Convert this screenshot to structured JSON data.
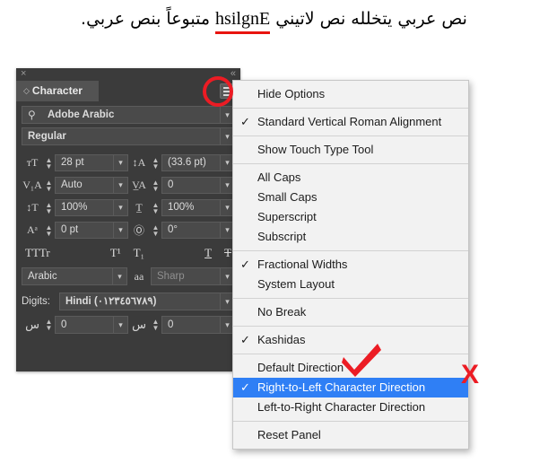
{
  "sample": {
    "line1_before": "نص عربي يتخلله نص لاتيني ",
    "latin_word": "hsilgnE",
    "line1_after": " متبوعاً بنص عربي.",
    "underline_color": "#e8140f"
  },
  "panel": {
    "title": "Character",
    "close_icon": "×",
    "collapse_icon": "«",
    "menu_icon": "hamburger-icon",
    "font_family": {
      "value": "Adobe Arabic",
      "search_icon": "⌕"
    },
    "font_style": {
      "value": "Regular"
    },
    "metrics": [
      {
        "glyph": "T",
        "icon_name": "font-size-icon",
        "value": "28 pt"
      },
      {
        "glyph": "A",
        "icon_name": "leading-icon",
        "value": "(33.6 pt)"
      },
      {
        "glyph": "VA",
        "icon_name": "kerning-icon",
        "value": "Auto"
      },
      {
        "glyph": "VA",
        "icon_name": "tracking-icon",
        "value": "0"
      },
      {
        "glyph": "T",
        "icon_name": "vertical-scale-icon",
        "value": "100%"
      },
      {
        "glyph": "T",
        "icon_name": "horizontal-scale-icon",
        "value": "100%"
      },
      {
        "glyph": "A",
        "icon_name": "baseline-shift-icon",
        "value": "0 pt"
      },
      {
        "glyph": "T",
        "icon_name": "character-rotation-icon",
        "value": "0°"
      }
    ],
    "style_buttons": [
      {
        "label": "TT",
        "name": "all-caps-button"
      },
      {
        "label": "Tr",
        "name": "small-caps-button"
      },
      {
        "label": "T¹",
        "name": "superscript-button"
      },
      {
        "label": "T₁",
        "name": "subscript-button"
      },
      {
        "label": "T",
        "name": "underline-button"
      },
      {
        "label": "T",
        "name": "strikethrough-button"
      }
    ],
    "language": {
      "value": "Arabic",
      "aa_icon": "aa",
      "antialias": "Sharp"
    },
    "digits": {
      "label": "Digits:",
      "value": "Hindi (٠١٢٣٤٥٦٧٨٩)"
    },
    "arabic_fields": [
      {
        "glyph": "س",
        "icon_name": "kashida-insertion-icon",
        "value": "0"
      },
      {
        "glyph": "س",
        "icon_name": "diacritic-vertical-position-icon",
        "value": "0"
      }
    ]
  },
  "menu": {
    "groups": [
      {
        "items": [
          {
            "label": "Hide Options",
            "checked": false,
            "selected": false
          }
        ]
      },
      {
        "items": [
          {
            "label": "Standard Vertical Roman Alignment",
            "checked": true,
            "selected": false
          }
        ]
      },
      {
        "items": [
          {
            "label": "Show Touch Type Tool",
            "checked": false,
            "selected": false
          }
        ]
      },
      {
        "items": [
          {
            "label": "All Caps",
            "checked": false,
            "selected": false
          },
          {
            "label": "Small Caps",
            "checked": false,
            "selected": false
          },
          {
            "label": "Superscript",
            "checked": false,
            "selected": false
          },
          {
            "label": "Subscript",
            "checked": false,
            "selected": false
          }
        ]
      },
      {
        "items": [
          {
            "label": "Fractional Widths",
            "checked": true,
            "selected": false
          },
          {
            "label": "System Layout",
            "checked": false,
            "selected": false
          }
        ]
      },
      {
        "items": [
          {
            "label": "No Break",
            "checked": false,
            "selected": false
          }
        ]
      },
      {
        "items": [
          {
            "label": "Kashidas",
            "checked": true,
            "selected": false
          }
        ]
      },
      {
        "items": [
          {
            "label": "Default Direction",
            "checked": false,
            "selected": false
          },
          {
            "label": "Right-to-Left Character Direction",
            "checked": true,
            "selected": true
          },
          {
            "label": "Left-to-Right Character Direction",
            "checked": false,
            "selected": false
          }
        ]
      },
      {
        "items": [
          {
            "label": "Reset Panel",
            "checked": false,
            "selected": false
          }
        ]
      }
    ],
    "check_glyph": "✓",
    "highlight_color": "#2f7ff5"
  },
  "annotations": {
    "red_check_icon": "red-checkmark",
    "red_x_label": "X",
    "ring_icon": "red-circle-highlight",
    "color": "#ec1c24"
  }
}
